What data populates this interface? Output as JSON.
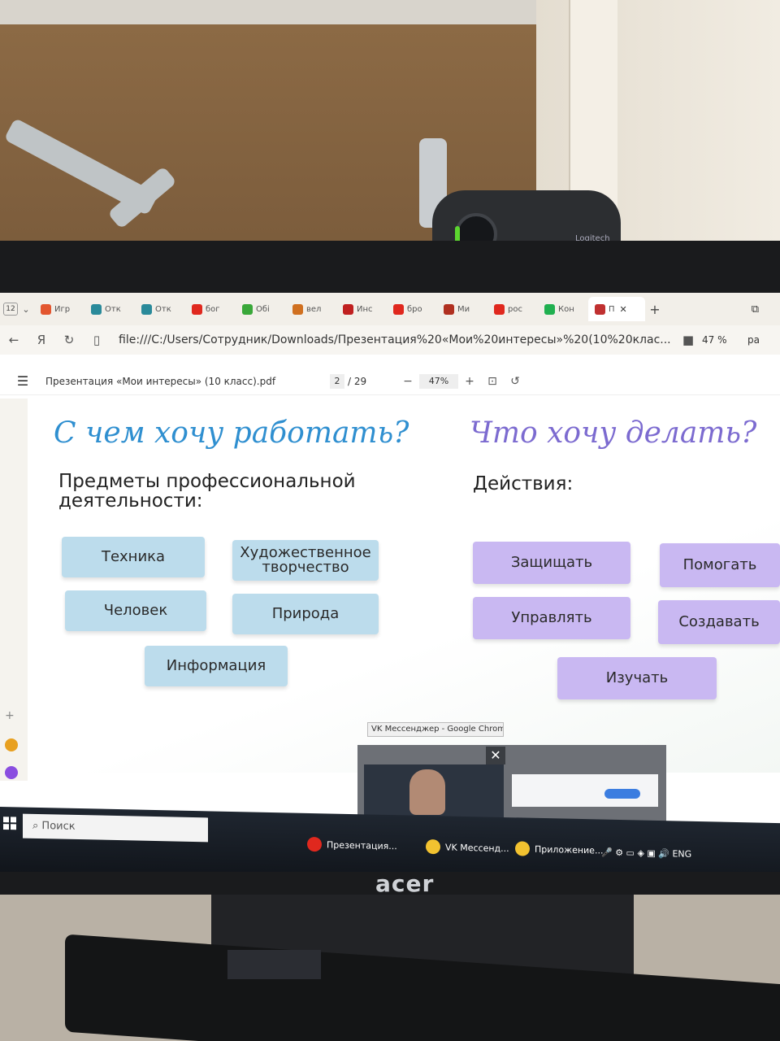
{
  "webcam": {
    "brand": "Logitech"
  },
  "monitor": {
    "brand": "acer"
  },
  "browser": {
    "tab_count": "12",
    "tabs": [
      {
        "label": "Игр",
        "color": "#e3562f"
      },
      {
        "label": "Отк",
        "color": "#2a8a9a"
      },
      {
        "label": "Отк",
        "color": "#2a8a9a"
      },
      {
        "label": "бог",
        "color": "#e0281e"
      },
      {
        "label": "Обі",
        "color": "#3aa83a"
      },
      {
        "label": "вел",
        "color": "#d07020"
      },
      {
        "label": "Инс",
        "color": "#c02020"
      },
      {
        "label": "бро",
        "color": "#e0281e"
      },
      {
        "label": "Ми",
        "color": "#b03020"
      },
      {
        "label": "рос",
        "color": "#e0281e"
      },
      {
        "label": "Кон",
        "color": "#20b050"
      }
    ],
    "active_tab": {
      "label": "П",
      "color": "#c03030"
    },
    "url": "file:///C:/Users/Сотрудник/Downloads/Презентация%20«Мои%20интересы»%20(10%20клас...",
    "zoom": "47 %",
    "print_label": "ра"
  },
  "pdf_toolbar": {
    "title": "Презентация «Мои интересы» (10 класс).pdf",
    "page": "2",
    "page_total": "/ 29",
    "zoom": "47%"
  },
  "slide": {
    "left_heading": "С чем хочу работать?",
    "left_subheading": "Предметы профессиональной деятельности:",
    "right_heading": "Что хочу делать?",
    "right_subheading": "Действия:",
    "subjects": [
      "Техника",
      "Художественное творчество",
      "Человек",
      "Природа",
      "Информация"
    ],
    "actions": [
      "Защищать",
      "Помогать",
      "Управлять",
      "Создавать",
      "Изучать"
    ]
  },
  "vk_popup": {
    "title": "VK Мессенджер - Google Chrome"
  },
  "taskbar": {
    "search_placeholder": "Поиск",
    "apps": [
      {
        "label": "Презентация...",
        "color": "#e0281e"
      },
      {
        "label": "VK Мессенд...",
        "color": "#f2c230"
      },
      {
        "label": "Приложение...",
        "color": "#f2c230"
      }
    ],
    "language": "ENG"
  }
}
